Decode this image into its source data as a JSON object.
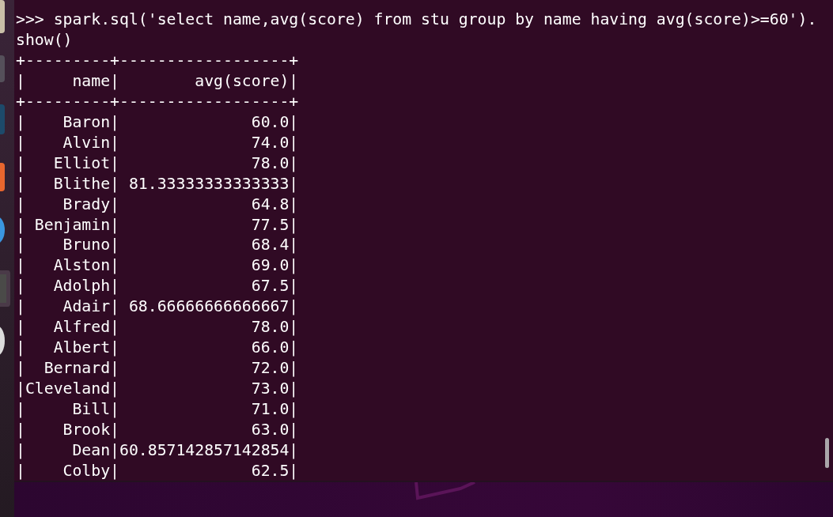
{
  "terminal": {
    "lines": [
      ">>> spark.sql('select name,avg(score) from stu group by name having avg(score)>=60').",
      "show()",
      "+---------+------------------+",
      "|     name|        avg(score)|",
      "+---------+------------------+",
      "|    Baron|              60.0|",
      "|    Alvin|              74.0|",
      "|   Elliot|              78.0|",
      "|   Blithe| 81.33333333333333|",
      "|    Brady|              64.8|",
      "| Benjamin|              77.5|",
      "|    Bruno|              68.4|",
      "|   Alston|              69.0|",
      "|   Adolph|              67.5|",
      "|    Adair| 68.66666666666667|",
      "|   Alfred|              78.0|",
      "|   Albert|              66.0|",
      "|  Bernard|              72.0|",
      "|Cleveland|              73.0|",
      "|     Bill|              71.0|",
      "|    Brook|              63.0|",
      "|     Dean|60.857142857142854|",
      "|    Colby|              62.5|"
    ]
  }
}
